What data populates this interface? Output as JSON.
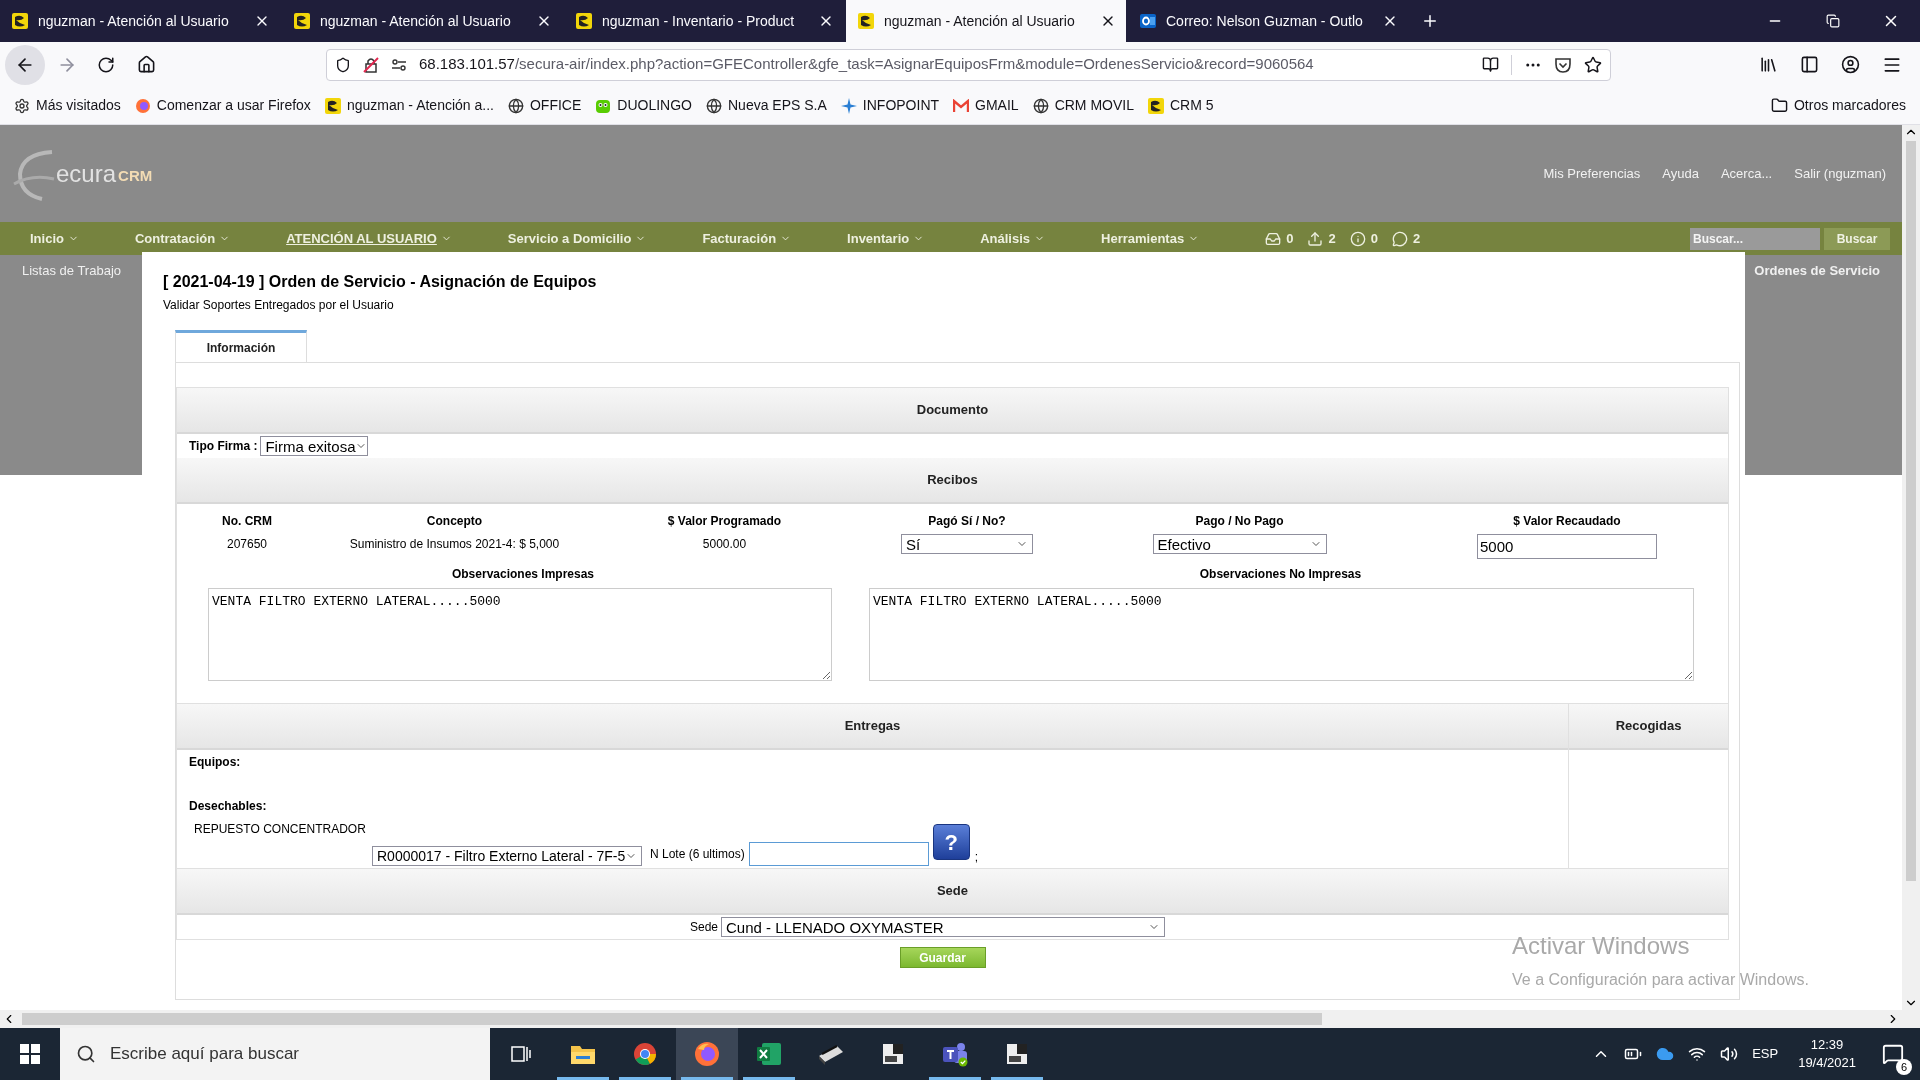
{
  "browser": {
    "tabs": [
      {
        "label": "nguzman - Atención al Usuario",
        "selected": false,
        "kind": "secura"
      },
      {
        "label": "nguzman - Atención al Usuario",
        "selected": false,
        "kind": "secura"
      },
      {
        "label": "nguzman - Inventario - Product",
        "selected": false,
        "kind": "secura"
      },
      {
        "label": "nguzman - Atención al Usuario",
        "selected": true,
        "kind": "secura"
      },
      {
        "label": "Correo: Nelson Guzman - Outlo",
        "selected": false,
        "kind": "outlook"
      }
    ],
    "url_host": "68.183.101.57",
    "url_path": "/secura-air/index.php?action=GFEController&gfe_task=AsignarEquiposFrm&module=OrdenesServicio&record=9060564",
    "bookmarks": [
      {
        "label": "Más visitados",
        "kind": "gear"
      },
      {
        "label": "Comenzar a usar Firefox",
        "kind": "firefox"
      },
      {
        "label": "nguzman - Atención a...",
        "kind": "secura"
      },
      {
        "label": "OFFICE",
        "kind": "globe"
      },
      {
        "label": "DUOLINGO",
        "kind": "owl"
      },
      {
        "label": "Nueva EPS S.A",
        "kind": "globe"
      },
      {
        "label": "INFOPOINT",
        "kind": "spark"
      },
      {
        "label": "GMAIL",
        "kind": "gmail"
      },
      {
        "label": "CRM MOVIL",
        "kind": "globe"
      },
      {
        "label": "CRM 5",
        "kind": "secura"
      }
    ],
    "other_bookmarks": "Otros marcadores"
  },
  "app": {
    "logo": {
      "text": "ecura",
      "suffix": "CRM"
    },
    "top_links": [
      "Mis Preferencias",
      "Ayuda",
      "Acerca...",
      "Salir (nguzman)"
    ],
    "menu": [
      {
        "label": "Inicio",
        "selected": false
      },
      {
        "label": "Contratación",
        "selected": false
      },
      {
        "label": "ATENCIÓN AL USUARIO",
        "selected": true
      },
      {
        "label": "Servicio a Domicilio",
        "selected": false
      },
      {
        "label": "Facturación",
        "selected": false
      },
      {
        "label": "Inventario",
        "selected": false
      },
      {
        "label": "Análisis",
        "selected": false
      },
      {
        "label": "Herramientas",
        "selected": false
      }
    ],
    "counters": [
      {
        "kind": "inbox",
        "count": "0"
      },
      {
        "kind": "outbox",
        "count": "2"
      },
      {
        "kind": "alert",
        "count": "0"
      },
      {
        "kind": "chat",
        "count": "2"
      }
    ],
    "search": {
      "placeholder": "Buscar..."
    },
    "search_button": "Buscar",
    "submenu": [
      {
        "label": "Listas de Trabajo",
        "selected": false
      },
      {
        "label": "Ordenes de Servicio",
        "selected": true
      }
    ]
  },
  "dialog": {
    "title": "[ 2021-04-19 ] Orden de Servicio - Asignación de Equipos",
    "subtitle": "Validar Soportes Entregados por el Usuario",
    "tabs": [
      {
        "label": "Información",
        "selected": true
      }
    ],
    "documento": {
      "header": "Documento",
      "tipo_firma_label": "Tipo Firma :",
      "tipo_firma": "Firma exitosa"
    },
    "recibos": {
      "header": "Recibos",
      "columns": [
        "No. CRM",
        "Concepto",
        "$ Valor Programado",
        "Pagó Sí / No?",
        "Pago / No Pago",
        "$ Valor Recaudado"
      ],
      "row": {
        "crm": "207650",
        "concepto": "Suministro de Insumos 2021-4: $ 5,000",
        "valor_programado": "5000.00",
        "pago_si_no": "Sí",
        "pago": "Efectivo",
        "valor_recaudado": "5000"
      },
      "obs_impresas_label": "Observaciones Impresas",
      "obs_impresas": "VENTA FILTRO EXTERNO LATERAL.....5000",
      "obs_no_impresas_label": "Observaciones No Impresas",
      "obs_no_impresas": "VENTA FILTRO EXTERNO LATERAL.....5000"
    },
    "entregas": {
      "header": "Entregas",
      "recogidas_header": "Recogidas",
      "equipos_label": "Equipos:",
      "desechables_label": "Desechables:",
      "item_name": "REPUESTO CONCENTRADOR",
      "item_select": "R0000017 - Filtro Externo Lateral - 7F-5",
      "lote_label": "N Lote (6 ultimos)",
      "help": "?",
      "trailing": ";"
    },
    "sede": {
      "header": "Sede",
      "label": "Sede",
      "value": "Cund - LLENADO OXYMASTER"
    },
    "save_button": "Guardar"
  },
  "activation": {
    "title": "Activar Windows",
    "text": "Ve a Configuración para activar Windows."
  },
  "taskbar": {
    "search_placeholder": "Escribe aquí para buscar",
    "apps": [
      {
        "kind": "taskview",
        "running": false,
        "selected": false
      },
      {
        "kind": "explorer",
        "running": true,
        "selected": false
      },
      {
        "kind": "chrome",
        "running": true,
        "selected": false
      },
      {
        "kind": "firefox",
        "running": true,
        "selected": true
      },
      {
        "kind": "excel",
        "running": true,
        "selected": false
      },
      {
        "kind": "scanner",
        "running": false,
        "selected": false
      },
      {
        "kind": "printer",
        "running": false,
        "selected": false
      },
      {
        "kind": "teams",
        "running": true,
        "selected": false
      },
      {
        "kind": "printer",
        "running": true,
        "selected": false
      }
    ],
    "language": "ESP",
    "time": "12:39",
    "date": "19/4/2021",
    "notifications": "6"
  }
}
